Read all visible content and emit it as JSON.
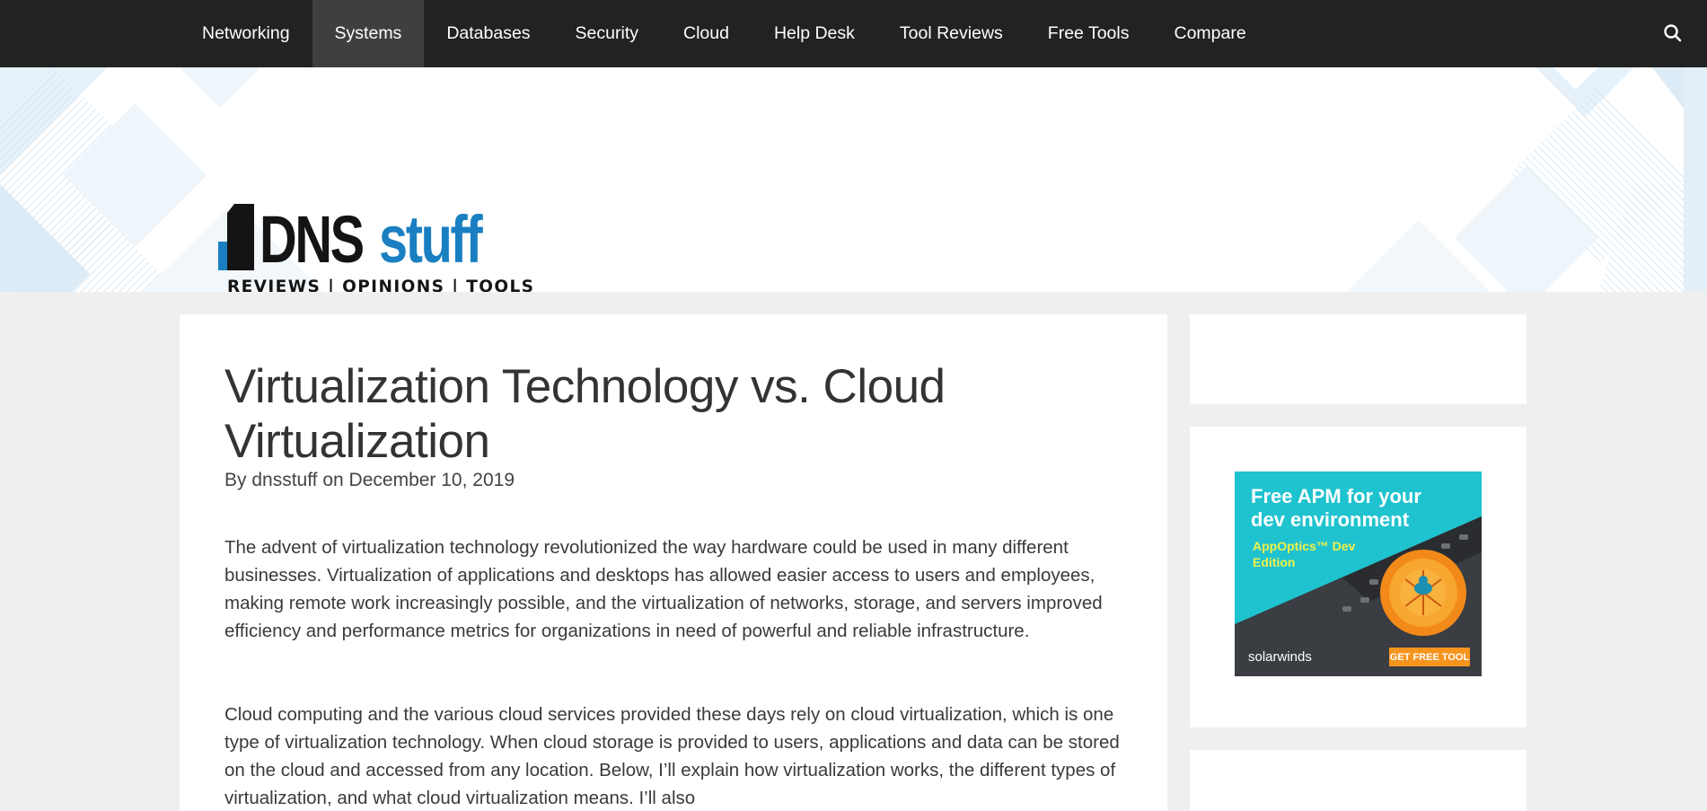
{
  "nav": {
    "items": [
      {
        "label": "Networking",
        "active": false
      },
      {
        "label": "Systems",
        "active": true
      },
      {
        "label": "Databases",
        "active": false
      },
      {
        "label": "Security",
        "active": false
      },
      {
        "label": "Cloud",
        "active": false
      },
      {
        "label": "Help Desk",
        "active": false
      },
      {
        "label": "Tool Reviews",
        "active": false
      },
      {
        "label": "Free Tools",
        "active": false
      },
      {
        "label": "Compare",
        "active": false
      }
    ],
    "search_icon": "search-icon"
  },
  "logo": {
    "part1": "DNS",
    "part2": "stuff",
    "tagline": "REVIEWS | OPINIONS | TOOLS"
  },
  "article": {
    "title": "Virtualization Technology vs. Cloud Virtualization",
    "byline_prefix": "By ",
    "author": "dnsstuff",
    "byline_on": " on ",
    "date": "December 10, 2019",
    "paragraphs": [
      "The advent of virtualization technology revolutionized the way hardware could be used in many different businesses. Virtualization of applications and desktops has allowed easier access to users and employees, making remote work increasingly possible, and the virtualization of networks, storage, and servers improved efficiency and performance metrics for organizations in need of powerful and reliable infrastructure.",
      "Cloud computing and the various cloud services provided these days rely on cloud virtualization, which is one type of virtualization technology. When cloud storage is provided to users, applications and data can be stored on the cloud and accessed from any location. Below, I’ll explain how virtualization works, the different types of virtualization, and what cloud virtualization means. I’ll also"
    ]
  },
  "ad": {
    "headline": "Free APM for your dev environment",
    "product": "AppOptics™ Dev Edition",
    "brand": "solarwinds",
    "cta": "GET FREE TOOL"
  },
  "colors": {
    "nav_bg": "#222222",
    "nav_active": "#3f3f3f",
    "brand_blue": "#1a7fc1",
    "page_bg": "#efefef",
    "ad_teal": "#1fc3cf",
    "ad_cta": "#f7941d"
  }
}
